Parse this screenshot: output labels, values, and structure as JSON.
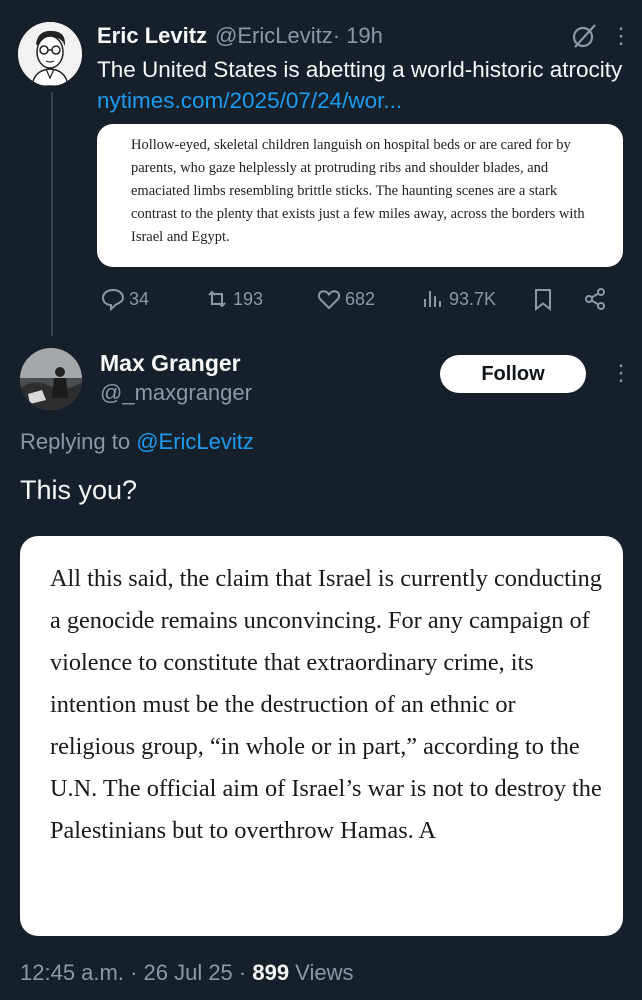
{
  "parent_tweet": {
    "author_name": "Eric Levitz",
    "author_handle": "@EricLevitz",
    "time": " · 19h",
    "text": "The United States is abetting a world-historic atrocity ",
    "link": "nytimes.com/2025/07/24/wor...",
    "quote_text": "Hollow-eyed, skeletal children languish on hospital beds or are cared for by parents, who gaze helplessly at protruding ribs and shoulder blades, and emaciated limbs resembling brittle sticks. The haunting scenes are a stark contrast to the plenty that exists just a few miles away, across the borders with Israel and Egypt.",
    "stats": {
      "replies": "34",
      "reposts": "193",
      "likes": "682",
      "views": "93.7K"
    }
  },
  "reply_tweet": {
    "author_name": "Max Granger",
    "author_handle": "@_maxgranger",
    "follow_label": "Follow",
    "replying_prefix": "Replying to ",
    "replying_to": "@EricLevitz",
    "text": "This you?",
    "quote_text": "All this said, the claim that Israel is currently conducting a genocide remains unconvincing. For any campaign of violence to constitute that extraordinary crime, its intention must be the destruction of an ethnic or religious group, “in whole or in part,” according to the U.N. The official aim of Israel’s war is not to destroy the Palestinians but to overthrow Hamas. A",
    "timestamp": "12:45 a.m. · 26 Jul 25 · ",
    "views_count": "899",
    "views_label": " Views"
  },
  "colors": {
    "background": "#15202b",
    "accent": "#1d9bf0",
    "secondary_text": "#8b98a5"
  }
}
